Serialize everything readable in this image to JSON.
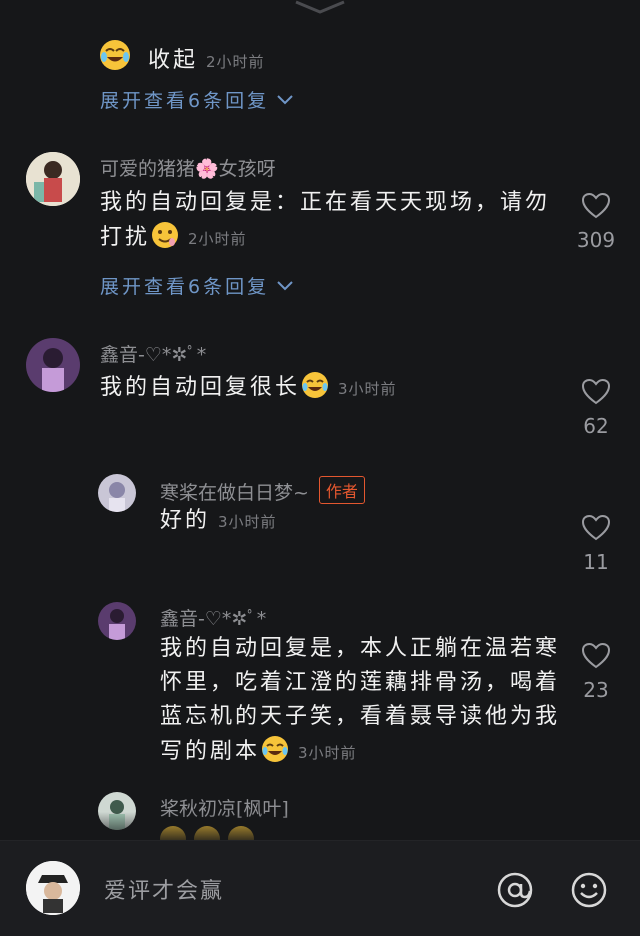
{
  "thread1": {
    "collapse_text": "收起",
    "time": "2小时前",
    "expand_text": "展开查看6条回复"
  },
  "comment1": {
    "username": "可爱的猪猪🌸女孩呀",
    "text": "我的自动回复是：正在看天天现场，请勿打扰",
    "time": "2小时前",
    "likes": "309",
    "expand_text": "展开查看6条回复"
  },
  "comment2": {
    "username": "鑫音-♡*✲ﾟ*",
    "text": "我的自动回复很长",
    "time": "3小时前",
    "likes": "62"
  },
  "reply1": {
    "username": "寒桨在做白日梦~",
    "badge": "作者",
    "text": "好的",
    "time": "3小时前",
    "likes": "11"
  },
  "reply2": {
    "username": "鑫音-♡*✲ﾟ*",
    "text": "我的自动回复是，本人正躺在温若寒怀里，吃着江澄的莲藕排骨汤，喝着蓝忘机的天子笑，看着聂导读他为我写的剧本",
    "time": "3小时前",
    "likes": "23"
  },
  "reply3": {
    "username": "桨秋初凉[枫叶]"
  },
  "bottom": {
    "placeholder": "爱评才会赢"
  },
  "colors": {
    "background": "#161719",
    "link": "#6f96c7",
    "author_badge": "#e3572f"
  },
  "icons": [
    "chevron-down-icon",
    "heart-icon",
    "at-icon",
    "smiley-icon",
    "crying-laughing-emoji",
    "drooling-emoji"
  ]
}
